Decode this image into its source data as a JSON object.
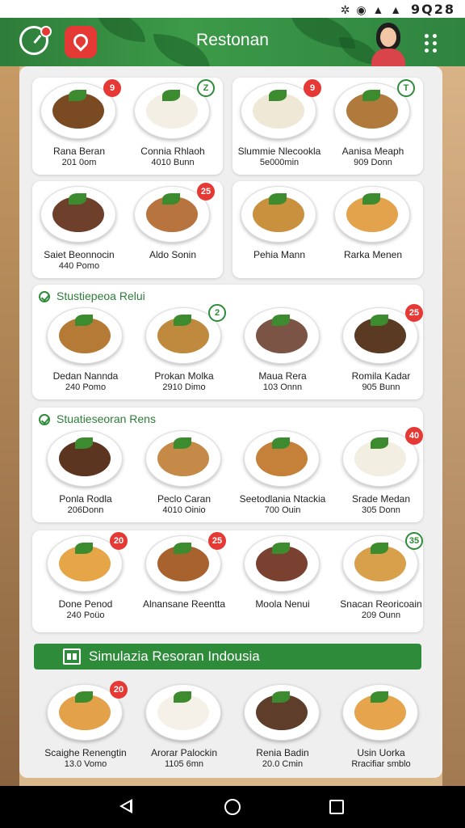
{
  "status_bar": {
    "icons": "✲ ◉ ▲ ▲",
    "time": "9Q28"
  },
  "header": {
    "title": "Restonan"
  },
  "rows": [
    {
      "cards": [
        {
          "items": [
            {
              "name": "Rana Beran",
              "price": "201 0om",
              "badge": "9",
              "badge_color": "red",
              "food": "#7a4a22"
            },
            {
              "name": "Connia Rhlaoh",
              "price": "4010 Bunn",
              "badge": "Z",
              "badge_color": "green",
              "food": "#f4efe4"
            }
          ]
        },
        {
          "items": [
            {
              "name": "Slummie Nlecookla",
              "price": "5e000min",
              "badge": "9",
              "badge_color": "red",
              "food": "#efe8d6"
            },
            {
              "name": "Aanisa Meaph",
              "price": "909 Donn",
              "badge": "T",
              "badge_color": "green",
              "food": "#b07a3c"
            }
          ]
        }
      ]
    },
    {
      "cards": [
        {
          "items": [
            {
              "name": "Saiet Beonnocin",
              "price": "440 Pomo",
              "badge": "",
              "badge_color": "",
              "food": "#6e3f2a"
            },
            {
              "name": "Aldo Sonin",
              "price": "",
              "badge": "25",
              "badge_color": "red",
              "food": "#b8743e"
            }
          ]
        },
        {
          "items": [
            {
              "name": "Pehia Mann",
              "price": "",
              "badge": "",
              "badge_color": "",
              "food": "#c9913e"
            },
            {
              "name": "Rarka Menen",
              "price": "",
              "badge": "",
              "badge_color": "",
              "food": "#e3a24c"
            }
          ]
        }
      ]
    }
  ],
  "sections": [
    {
      "title": "Stustiepeoa Relui",
      "items": [
        {
          "name": "Dedan Nannda",
          "price": "240 Pomo",
          "badge": "",
          "badge_color": "",
          "food": "#b57a36"
        },
        {
          "name": "Prokan Molka",
          "price": "2910 Dimo",
          "badge": "2",
          "badge_color": "green",
          "food": "#c08a3e"
        },
        {
          "name": "Maua Rera",
          "price": "103 Onnn",
          "badge": "",
          "badge_color": "",
          "food": "#7b5446"
        },
        {
          "name": "Romila Kadar",
          "price": "905 Bunn",
          "badge": "25",
          "badge_color": "red",
          "food": "#5a3a22"
        }
      ]
    },
    {
      "title": "Stuatieseoran Rens",
      "items": [
        {
          "name": "Ponla Rodla",
          "price": "206Donn",
          "badge": "",
          "badge_color": "",
          "food": "#5b3520"
        },
        {
          "name": "Peclo Caran",
          "price": "4010 Oinio",
          "badge": "",
          "badge_color": "",
          "food": "#c68a48"
        },
        {
          "name": "Seetodlania Ntackia",
          "price": "700 Ouin",
          "badge": "",
          "badge_color": "",
          "food": "#c5803a"
        },
        {
          "name": "Srade Medan",
          "price": "305 Donn",
          "badge": "40",
          "badge_color": "red",
          "food": "#f3eee2"
        }
      ]
    },
    {
      "title": "",
      "items": [
        {
          "name": "Done Penod",
          "price": "240 Poüo",
          "badge": "20",
          "badge_color": "red",
          "food": "#e6a547"
        },
        {
          "name": "Alnansane Reentta",
          "price": "",
          "badge": "25",
          "badge_color": "red",
          "food": "#a8622e"
        },
        {
          "name": "Moola Nenui",
          "price": "",
          "badge": "",
          "badge_color": "",
          "food": "#7a4030"
        },
        {
          "name": "Snacan Reoricoain",
          "price": "209 Ounn",
          "badge": "35",
          "badge_color": "green",
          "food": "#d9a04c"
        }
      ]
    }
  ],
  "banner": {
    "title": "Simulazia Resoran Indousia"
  },
  "bottom_items": [
    {
      "name": "Scaighe Renengtin",
      "price": "13.0 Vomo",
      "badge": "20",
      "badge_color": "red",
      "food": "#e3a24a"
    },
    {
      "name": "Arorar Palockin",
      "price": "1105 6mn",
      "badge": "",
      "badge_color": "",
      "food": "#f5f1e8"
    },
    {
      "name": "Renia Badin",
      "price": "20.0 Cmin",
      "badge": "",
      "badge_color": "",
      "food": "#5e3e2a"
    },
    {
      "name": "Usin Uorka",
      "price": "Rracifiar smblo",
      "badge": "",
      "badge_color": "",
      "food": "#e6a54c"
    }
  ],
  "nav": {
    "back": "back",
    "home": "home",
    "recent": "recent"
  }
}
